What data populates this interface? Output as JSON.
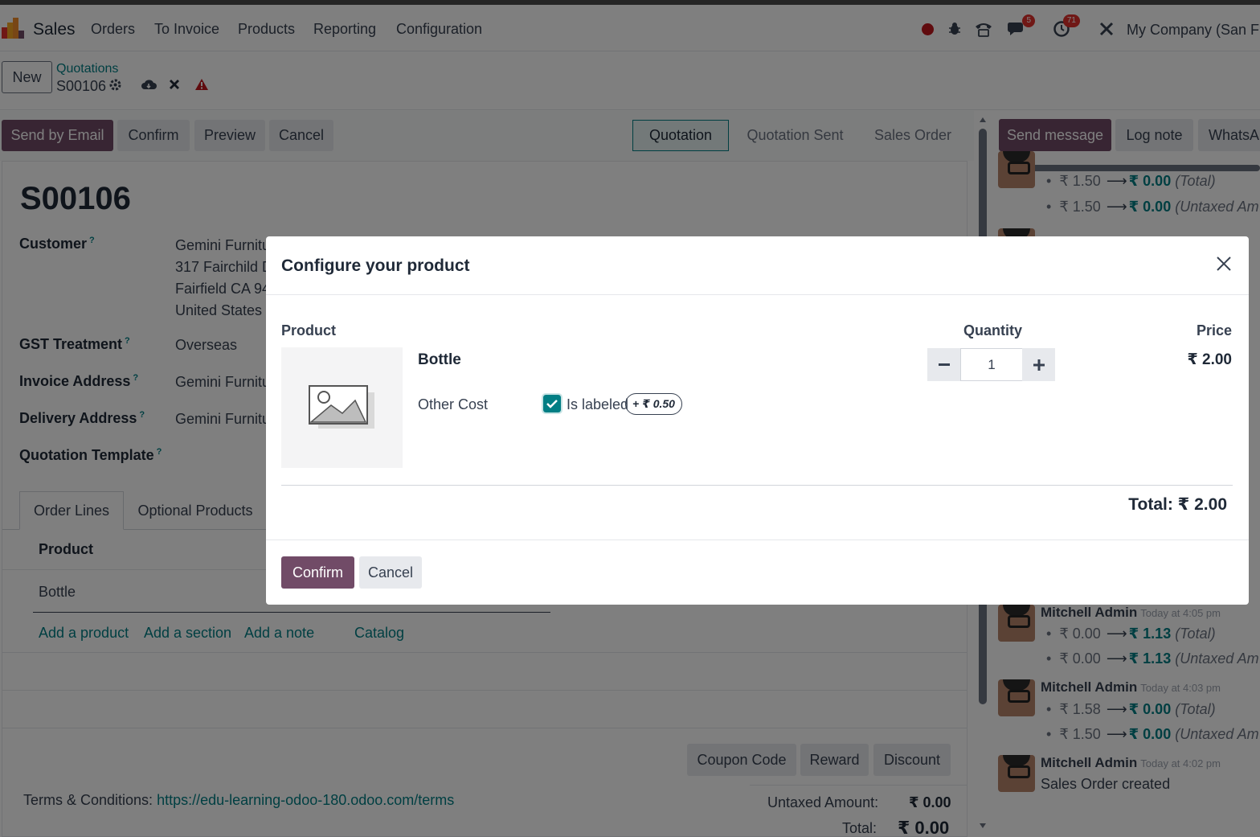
{
  "navbar": {
    "app_name": "Sales",
    "menu": [
      "Orders",
      "To Invoice",
      "Products",
      "Reporting",
      "Configuration"
    ],
    "messages_badge": "5",
    "activities_badge": "71",
    "company": "My Company (San Fra"
  },
  "breadcrumb": {
    "new_label": "New",
    "parent": "Quotations",
    "current": "S00106"
  },
  "statusbar": {
    "buttons": [
      "Send by Email",
      "Confirm",
      "Preview",
      "Cancel"
    ],
    "stages": [
      "Quotation",
      "Quotation Sent",
      "Sales Order"
    ],
    "active_stage": "Quotation"
  },
  "form": {
    "title": "S00106",
    "fields": {
      "customer": {
        "label": "Customer",
        "help": "?",
        "lines": [
          "Gemini Furnitu",
          "317 Fairchild D",
          "Fairfield CA 94",
          "United States -"
        ]
      },
      "gst": {
        "label": "GST Treatment",
        "help": "?",
        "value": "Overseas"
      },
      "invoice": {
        "label": "Invoice Address",
        "help": "?",
        "value": "Gemini Furnitu"
      },
      "delivery": {
        "label": "Delivery Address",
        "help": "?",
        "value": "Gemini Furnitu"
      },
      "template": {
        "label": "Quotation Template",
        "help": "?",
        "value": ""
      }
    },
    "tabs": [
      "Order Lines",
      "Optional Products"
    ],
    "table_header": "Product",
    "rows": [
      "Bottle"
    ],
    "add_links": [
      "Add a product",
      "Add a section",
      "Add a note",
      "Catalog"
    ],
    "footer_buttons": [
      "Coupon Code",
      "Reward",
      "Discount"
    ],
    "terms_label": "Terms & Conditions:",
    "terms_link": "https://edu-learning-odoo-180.odoo.com/terms",
    "untaxed_label": "Untaxed Amount:",
    "untaxed_value": "₹ 0.00",
    "total_label": "Total:",
    "total_value": "₹ 0.00"
  },
  "chatter": {
    "buttons": [
      "Send message",
      "Log note",
      "WhatsAp"
    ],
    "top_tracking": [
      {
        "old": "₹ 1.50",
        "new": "₹ 0.00",
        "field": "(Total)"
      },
      {
        "old": "₹ 1.50",
        "new": "₹ 0.00",
        "field": "(Untaxed Am"
      }
    ],
    "messages": [
      {
        "author": "Mitchell Admin",
        "time": "Today at 4:05 pm",
        "tracking": [
          {
            "old": "₹ 0.00",
            "new": "₹ 1.13",
            "field": "(Total)"
          },
          {
            "old": "₹ 0.00",
            "new": "₹ 1.13",
            "field": "(Untaxed Am"
          }
        ]
      },
      {
        "author": "Mitchell Admin",
        "time": "Today at 4:03 pm",
        "tracking": [
          {
            "old": "₹ 1.58",
            "new": "₹ 0.00",
            "field": "(Total)"
          },
          {
            "old": "₹ 1.50",
            "new": "₹ 0.00",
            "field": "(Untaxed Am"
          }
        ]
      },
      {
        "author": "Mitchell Admin",
        "time": "Today at 4:02 pm",
        "body": "Sales Order created"
      }
    ]
  },
  "modal": {
    "title": "Configure your product",
    "col_product": "Product",
    "col_quantity": "Quantity",
    "col_price": "Price",
    "product_name": "Bottle",
    "attribute_name": "Other Cost",
    "attribute_value": "Is labeled",
    "attribute_checked": true,
    "attribute_extra": "+ ₹ 0.50",
    "quantity": "1",
    "price": "₹ 2.00",
    "total": "Total: ₹ 2.00",
    "confirm_label": "Confirm",
    "cancel_label": "Cancel"
  },
  "colors": {
    "brand": "#714b67",
    "accent": "#017e84",
    "badge": "#e0312d"
  }
}
